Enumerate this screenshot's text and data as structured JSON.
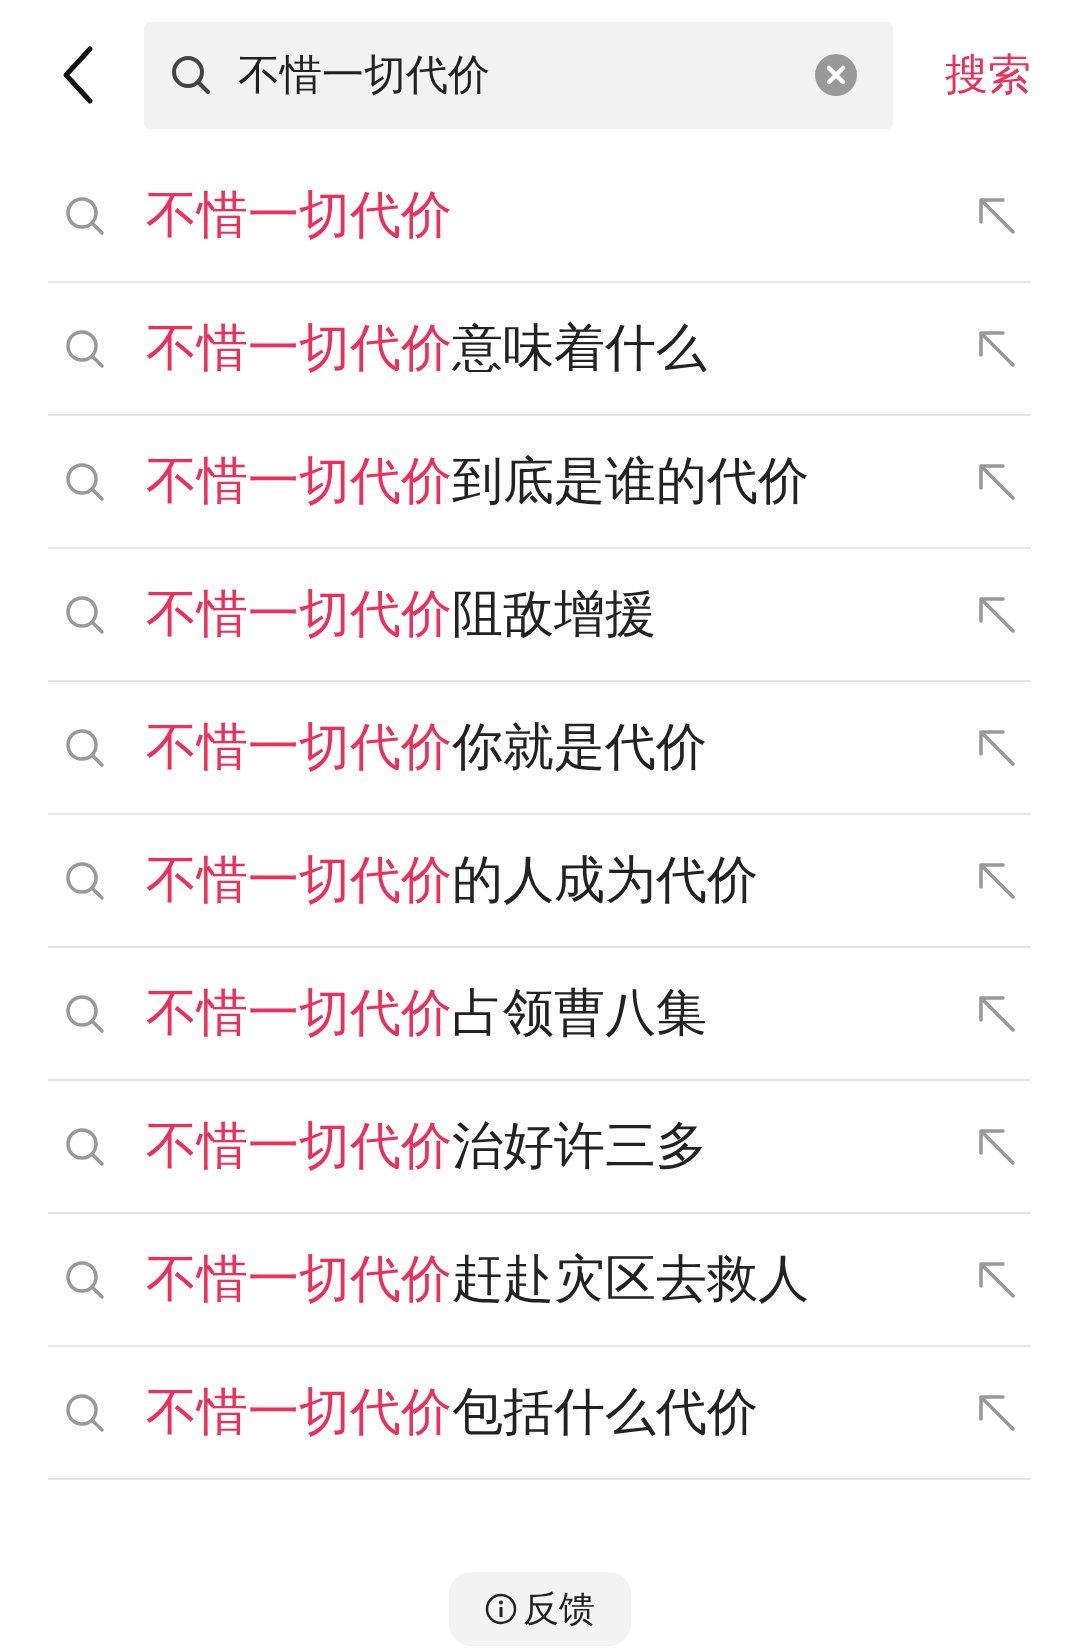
{
  "search_bar": {
    "query": "不惜一切代价",
    "search_button": "搜索"
  },
  "suggestions": [
    {
      "match": "不惜一切代价"
    },
    {
      "match": "不惜一切代价",
      "rest": "意味着什么"
    },
    {
      "match": "不惜一切代价",
      "rest": "到底是谁的代价"
    },
    {
      "match": "不惜一切代价",
      "rest": "阻敌增援"
    },
    {
      "match": "不惜一切代价",
      "rest": "你就是代价"
    },
    {
      "match": "不惜一切代价",
      "rest": "的人成为代价"
    },
    {
      "match": "不惜一切代价",
      "rest": "占领曹八集"
    },
    {
      "match": "不惜一切代价",
      "rest": "治好许三多"
    },
    {
      "match": "不惜一切代价",
      "rest": "赶赴灾区去救人"
    },
    {
      "match": "不惜一切代价",
      "rest": "包括什么代价"
    }
  ],
  "feedback_button": "反馈"
}
